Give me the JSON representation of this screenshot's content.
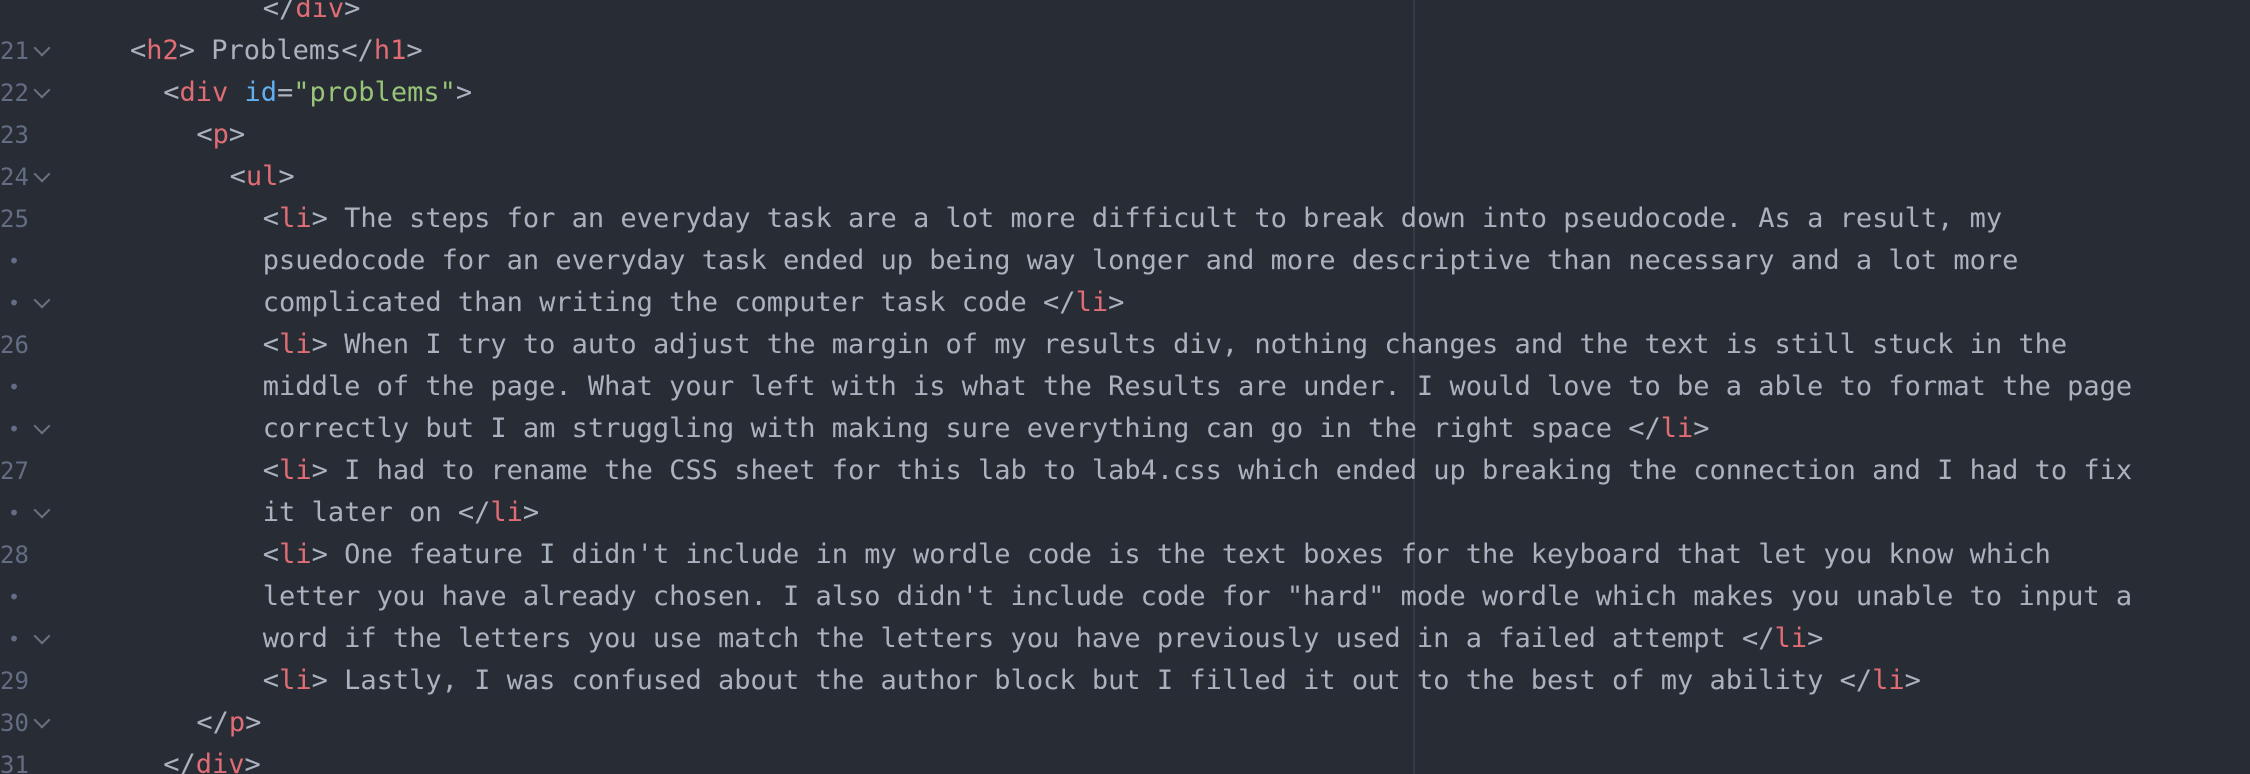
{
  "editor": {
    "colors": {
      "background": "#282c34",
      "text": "#abb2bf",
      "tag": "#e06c75",
      "attribute": "#61afef",
      "string": "#98c379",
      "line_number": "#636d83"
    },
    "lines": [
      {
        "ln": "",
        "fold": false,
        "indent": 12,
        "tokens": [
          [
            "p",
            "</"
          ],
          [
            "t",
            "div"
          ],
          [
            "p",
            ">"
          ]
        ]
      },
      {
        "ln": "21",
        "fold": true,
        "indent": 4,
        "tokens": [
          [
            "p",
            "<"
          ],
          [
            "t",
            "h2"
          ],
          [
            "p",
            "> Problems</"
          ],
          [
            "t",
            "h1"
          ],
          [
            "p",
            ">"
          ]
        ]
      },
      {
        "ln": "22",
        "fold": true,
        "indent": 6,
        "tokens": [
          [
            "p",
            "<"
          ],
          [
            "t",
            "div"
          ],
          [
            "p",
            " "
          ],
          [
            "a",
            "id"
          ],
          [
            "p",
            "="
          ],
          [
            "s",
            "\"problems\""
          ],
          [
            "p",
            ">"
          ]
        ]
      },
      {
        "ln": "23",
        "fold": false,
        "indent": 8,
        "tokens": [
          [
            "p",
            "<"
          ],
          [
            "t",
            "p"
          ],
          [
            "p",
            ">"
          ]
        ]
      },
      {
        "ln": "24",
        "fold": true,
        "indent": 10,
        "tokens": [
          [
            "p",
            "<"
          ],
          [
            "t",
            "ul"
          ],
          [
            "p",
            ">"
          ]
        ]
      },
      {
        "ln": "25",
        "fold": false,
        "indent": 12,
        "tokens": [
          [
            "p",
            "<"
          ],
          [
            "t",
            "li"
          ],
          [
            "p",
            "> The steps for an everyday task are a lot more difficult to break down into pseudocode. As a result, my"
          ]
        ]
      },
      {
        "ln": "•",
        "fold": false,
        "indent": 12,
        "wrap": true,
        "tokens": [
          [
            "p",
            "psuedocode for an everyday task ended up being way longer and more descriptive than necessary and a lot more"
          ]
        ]
      },
      {
        "ln": "•",
        "fold": true,
        "indent": 12,
        "wrap": true,
        "tokens": [
          [
            "p",
            "complicated than writing the computer task code </"
          ],
          [
            "t",
            "li"
          ],
          [
            "p",
            ">"
          ]
        ]
      },
      {
        "ln": "26",
        "fold": false,
        "indent": 12,
        "tokens": [
          [
            "p",
            "<"
          ],
          [
            "t",
            "li"
          ],
          [
            "p",
            "> When I try to auto adjust the margin of my results div, nothing changes and the text is still stuck in the"
          ]
        ]
      },
      {
        "ln": "•",
        "fold": false,
        "indent": 12,
        "wrap": true,
        "tokens": [
          [
            "p",
            "middle of the page. What your left with is what the Results are under. I would love to be a able to format the page"
          ]
        ]
      },
      {
        "ln": "•",
        "fold": true,
        "indent": 12,
        "wrap": true,
        "tokens": [
          [
            "p",
            "correctly but I am struggling with making sure everything can go in the right space </"
          ],
          [
            "t",
            "li"
          ],
          [
            "p",
            ">"
          ]
        ]
      },
      {
        "ln": "27",
        "fold": false,
        "indent": 12,
        "tokens": [
          [
            "p",
            "<"
          ],
          [
            "t",
            "li"
          ],
          [
            "p",
            "> I had to rename the CSS sheet for this lab to lab4.css which ended up breaking the connection and I had to fix"
          ]
        ]
      },
      {
        "ln": "•",
        "fold": true,
        "indent": 12,
        "wrap": true,
        "tokens": [
          [
            "p",
            "it later on </"
          ],
          [
            "t",
            "li"
          ],
          [
            "p",
            ">"
          ]
        ]
      },
      {
        "ln": "28",
        "fold": false,
        "indent": 12,
        "tokens": [
          [
            "p",
            "<"
          ],
          [
            "t",
            "li"
          ],
          [
            "p",
            "> One feature I didn't include in my wordle code is the text boxes for the keyboard that let you know which"
          ]
        ]
      },
      {
        "ln": "•",
        "fold": false,
        "indent": 12,
        "wrap": true,
        "tokens": [
          [
            "p",
            "letter you have already chosen. I also didn't include code for \"hard\" mode wordle which makes you unable to input a"
          ]
        ]
      },
      {
        "ln": "•",
        "fold": true,
        "indent": 12,
        "wrap": true,
        "tokens": [
          [
            "p",
            "word if the letters you use match the letters you have previously used in a failed attempt </"
          ],
          [
            "t",
            "li"
          ],
          [
            "p",
            ">"
          ]
        ]
      },
      {
        "ln": "29",
        "fold": false,
        "indent": 12,
        "tokens": [
          [
            "p",
            "<"
          ],
          [
            "t",
            "li"
          ],
          [
            "p",
            "> Lastly, I was confused about the author block but I filled it out to the best of my ability </"
          ],
          [
            "t",
            "li"
          ],
          [
            "p",
            ">"
          ]
        ]
      },
      {
        "ln": "30",
        "fold": true,
        "indent": 8,
        "tokens": [
          [
            "p",
            "</"
          ],
          [
            "t",
            "p"
          ],
          [
            "p",
            ">"
          ]
        ]
      },
      {
        "ln": "31",
        "fold": false,
        "indent": 6,
        "tokens": [
          [
            "p",
            "</"
          ],
          [
            "t",
            "div"
          ],
          [
            "p",
            ">"
          ]
        ]
      }
    ]
  }
}
